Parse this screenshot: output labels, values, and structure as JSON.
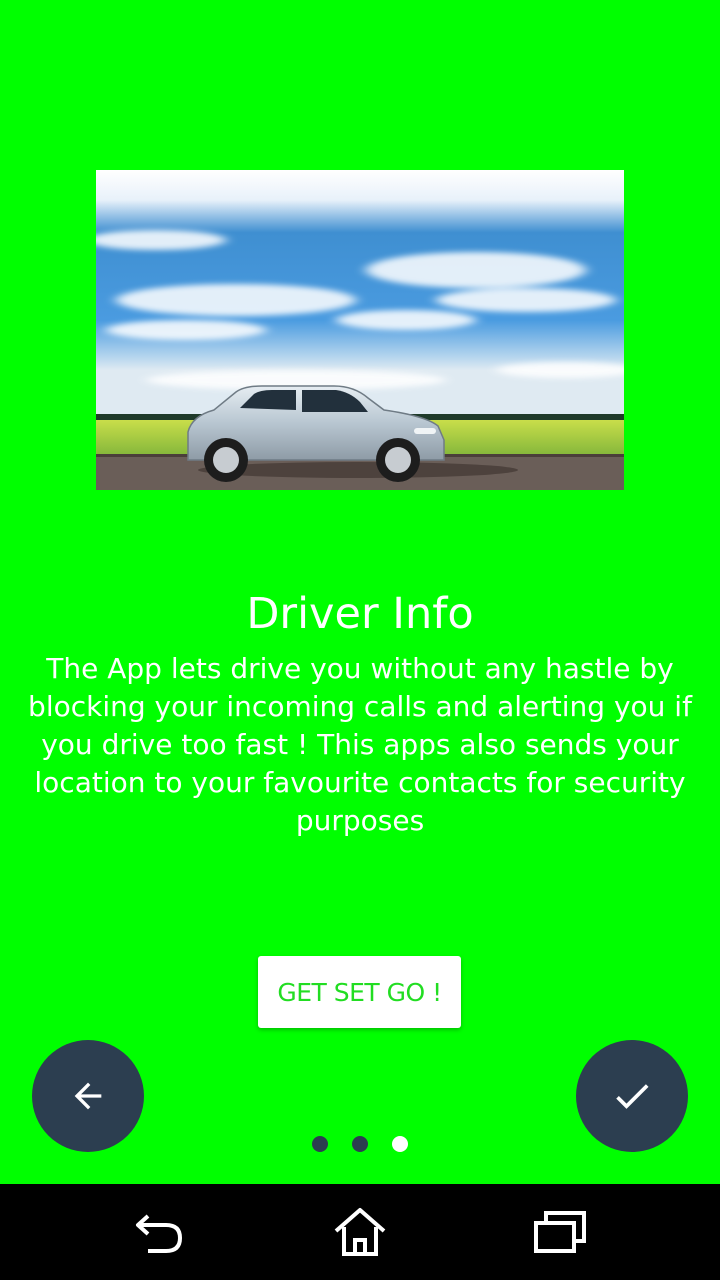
{
  "slide": {
    "title": "Driver Info",
    "description": "The App lets drive you without any hastle by blocking your incoming calls and alerting you if you drive too fast ! This apps also sends your location to your favourite contacts for security purposes",
    "button_label": "GET SET GO !",
    "background_color": "#00ff00"
  },
  "hero_image": {
    "subject": "silver hatchback car driving on road under blue cloudy sky"
  },
  "navigation": {
    "back_icon": "arrow-left-icon",
    "done_icon": "check-icon",
    "fab_color": "#2c3e50",
    "page_count": 3,
    "current_page": 3
  },
  "system_nav": {
    "icons": [
      "back-icon",
      "home-icon",
      "recent-apps-icon"
    ]
  }
}
